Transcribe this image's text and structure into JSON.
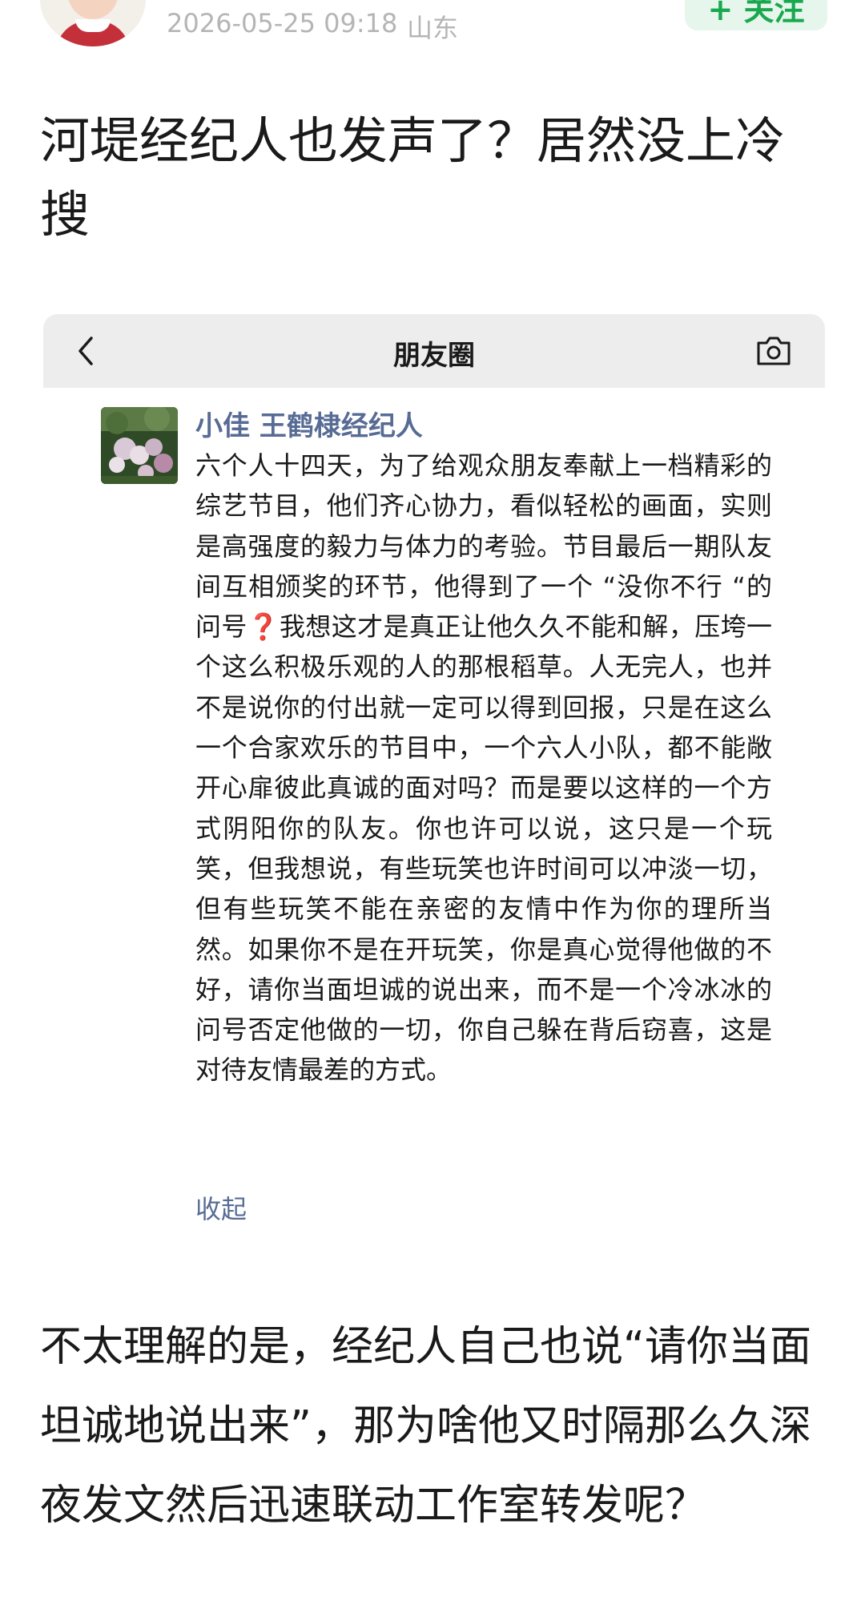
{
  "post": {
    "timestamp": "2026-05-25 09:18",
    "location": "山东",
    "follow_label": "+ 关注",
    "title": "河堤经纪人也发声了？居然没上冷搜",
    "commentary": "不太理解的是，经纪人自己也说“请你当面坦诚地说出来”，那为啥他又时隔那么久深夜发文然后迅速联动工作室转发呢？"
  },
  "wechat_moments": {
    "nav_title": "朋友圈",
    "icons": {
      "back": "chevron-left-icon",
      "camera": "camera-icon"
    },
    "author": "小佳 王鹤棣经纪人",
    "text": "六个人十四天，为了给观众朋友奉献上一档精彩的综艺节目，他们齐心协力，看似轻松的画面，实则是高强度的毅力与体力的考验。节目最后一期队友间互相颁奖的环节，他得到了一个 “没你不行 “的问号❓我想这才是真正让他久久不能和解，压垮一个这么积极乐观的人的那根稻草。人无完人，也并不是说你的付出就一定可以得到回报，只是在这么一个合家欢乐的节目中，一个六人小队，都不能敞开心扉彼此真诚的面对吗？而是要以这样的一个方式阴阳你的队友。你也许可以说，这只是一个玩笑，但我想说，有些玩笑也许时间可以冲淡一切，但有些玩笑不能在亲密的友情中作为你的理所当然。如果你不是在开玩笑，你是真心觉得他做的不好，请你当面坦诚的说出来，而不是一个冷冰冰的问号否定他做的一切，你自己躲在背后窃喜，这是对待友情最差的方式。",
    "collapse_label": "收起"
  },
  "colors": {
    "link_blue": "#576b95",
    "follow_green": "#1aa84f",
    "meta_gray": "#b5b5b5",
    "nav_bar_gray": "#ededed"
  }
}
